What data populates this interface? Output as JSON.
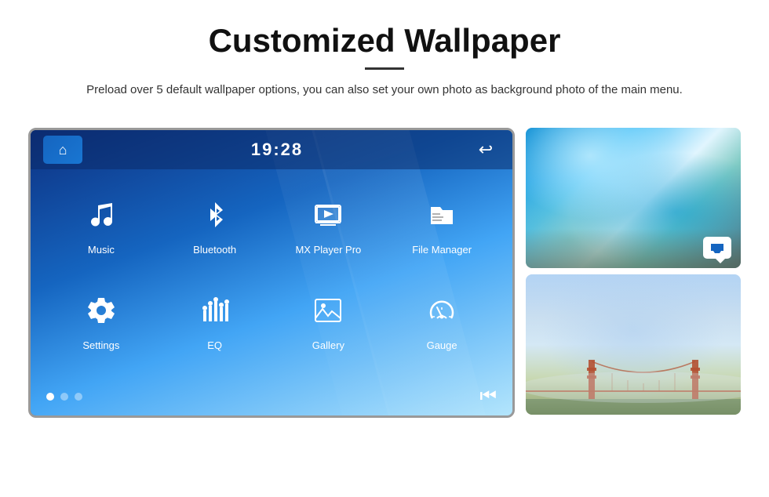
{
  "header": {
    "title": "Customized Wallpaper",
    "description": "Preload over 5 default wallpaper options, you can also set your own photo as background photo of the main menu."
  },
  "screen": {
    "time": "19:28",
    "apps_row1": [
      {
        "id": "music",
        "label": "Music",
        "icon": "music"
      },
      {
        "id": "bluetooth",
        "label": "Bluetooth",
        "icon": "bluetooth"
      },
      {
        "id": "mxplayer",
        "label": "MX Player Pro",
        "icon": "video"
      },
      {
        "id": "filemanager",
        "label": "File Manager",
        "icon": "folder"
      }
    ],
    "apps_row2": [
      {
        "id": "settings",
        "label": "Settings",
        "icon": "settings"
      },
      {
        "id": "eq",
        "label": "EQ",
        "icon": "equalizer"
      },
      {
        "id": "gallery",
        "label": "Gallery",
        "icon": "gallery"
      },
      {
        "id": "gauge",
        "label": "Gauge",
        "icon": "gauge"
      }
    ],
    "dots": [
      "active",
      "inactive",
      "inactive"
    ]
  },
  "images": {
    "top_alt": "Ice cave wallpaper",
    "bottom_alt": "Golden Gate Bridge wallpaper"
  }
}
